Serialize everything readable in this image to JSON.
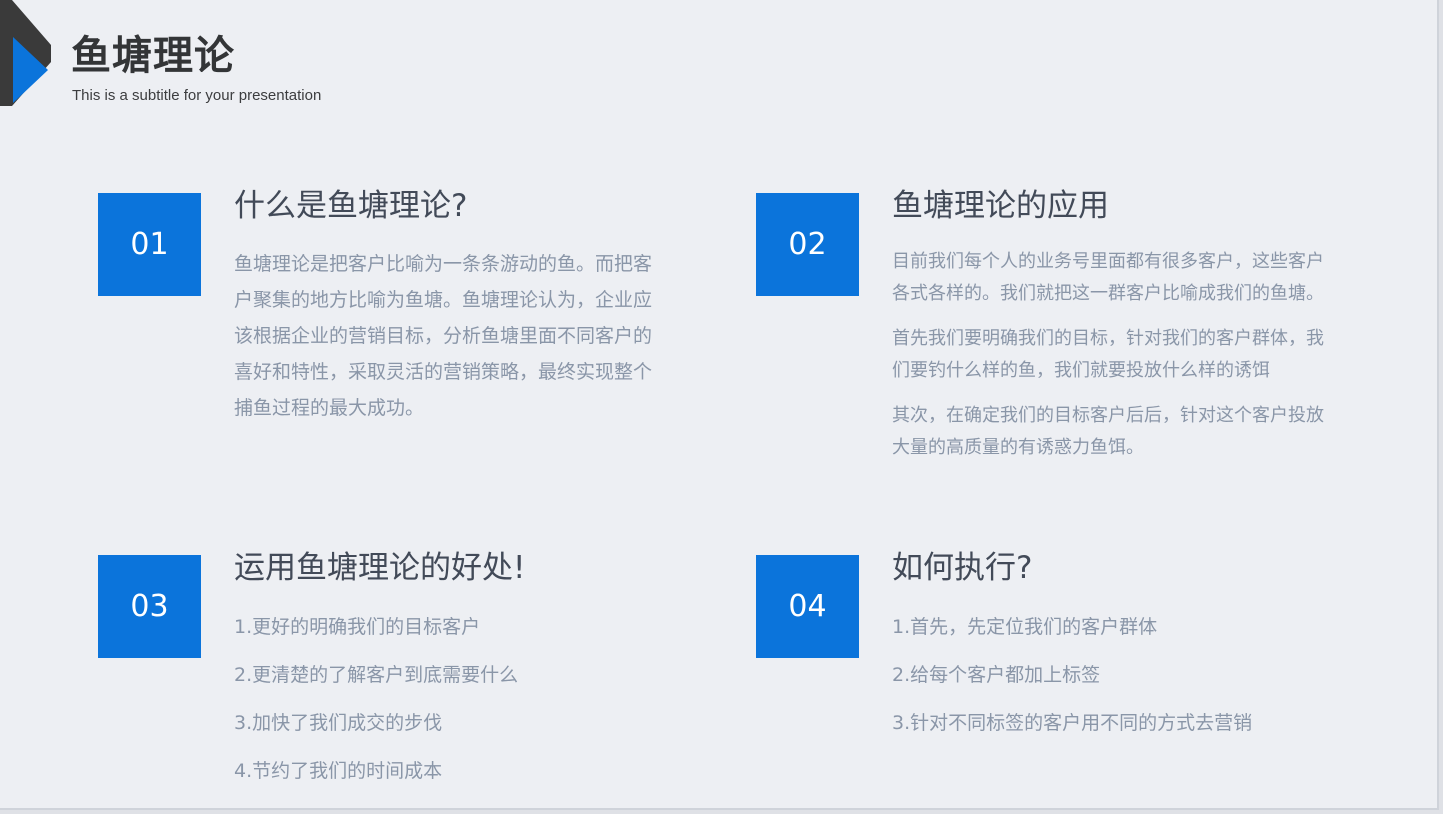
{
  "header": {
    "title": "鱼塘理论",
    "subtitle": "This is a subtitle for your presentation"
  },
  "colors": {
    "accent": "#0b74db",
    "logo_dark": "#3a3a3a",
    "logo_blue": "#0b74db",
    "background": "#edeff3",
    "heading": "#424a58",
    "body_text": "#8a96a8"
  },
  "sections": [
    {
      "number": "01",
      "heading": "什么是鱼塘理论?",
      "paragraphs": [
        "鱼塘理论是把客户比喻为一条条游动的鱼。而把客户聚集的地方比喻为鱼塘。鱼塘理论认为，企业应该根据企业的营销目标，分析鱼塘里面不同客户的喜好和特性，采取灵活的营销策略，最终实现整个捕鱼过程的最大成功。"
      ]
    },
    {
      "number": "02",
      "heading": "鱼塘理论的应用",
      "paragraphs": [
        "目前我们每个人的业务号里面都有很多客户，这些客户各式各样的。我们就把这一群客户比喻成我们的鱼塘。",
        "首先我们要明确我们的目标，针对我们的客户群体，我们要钓什么样的鱼，我们就要投放什么样的诱饵",
        "其次，在确定我们的目标客户后后，针对这个客户投放大量的高质量的有诱惑力鱼饵。"
      ]
    },
    {
      "number": "03",
      "heading": "运用鱼塘理论的好处!",
      "items": [
        "1.更好的明确我们的目标客户",
        "2.更清楚的了解客户到底需要什么",
        "3.加快了我们成交的步伐",
        "4.节约了我们的时间成本"
      ]
    },
    {
      "number": "04",
      "heading": "如何执行?",
      "items": [
        "1.首先，先定位我们的客户群体",
        "2.给每个客户都加上标签",
        "3.针对不同标签的客户用不同的方式去营销"
      ]
    }
  ]
}
